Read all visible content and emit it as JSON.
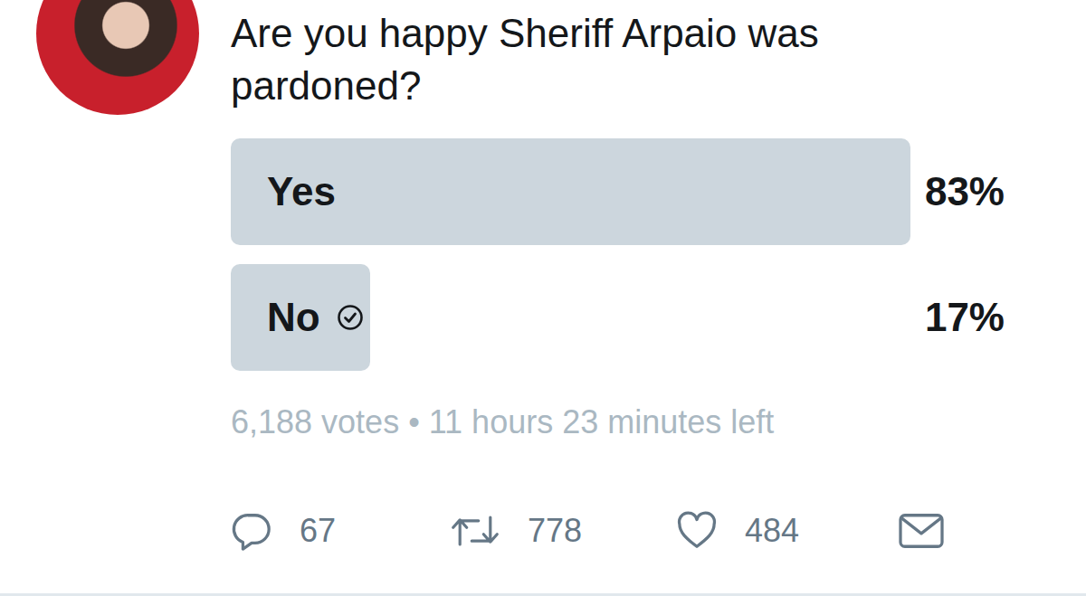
{
  "tweet": {
    "question": "Are you happy Sheriff Arpaio was pardoned?"
  },
  "poll": {
    "options": [
      {
        "label": "Yes",
        "percent": "83%",
        "level": 0.83,
        "selected": false
      },
      {
        "label": "No",
        "percent": "17%",
        "level": 0.17,
        "selected": true
      }
    ],
    "votes": "6,188 votes",
    "separator": "•",
    "time_left": "11 hours 23 minutes left"
  },
  "actions": [
    {
      "kind": "reply",
      "count": "67"
    },
    {
      "kind": "retweet",
      "count": "778"
    },
    {
      "kind": "like",
      "count": "484"
    },
    {
      "kind": "message"
    }
  ]
}
